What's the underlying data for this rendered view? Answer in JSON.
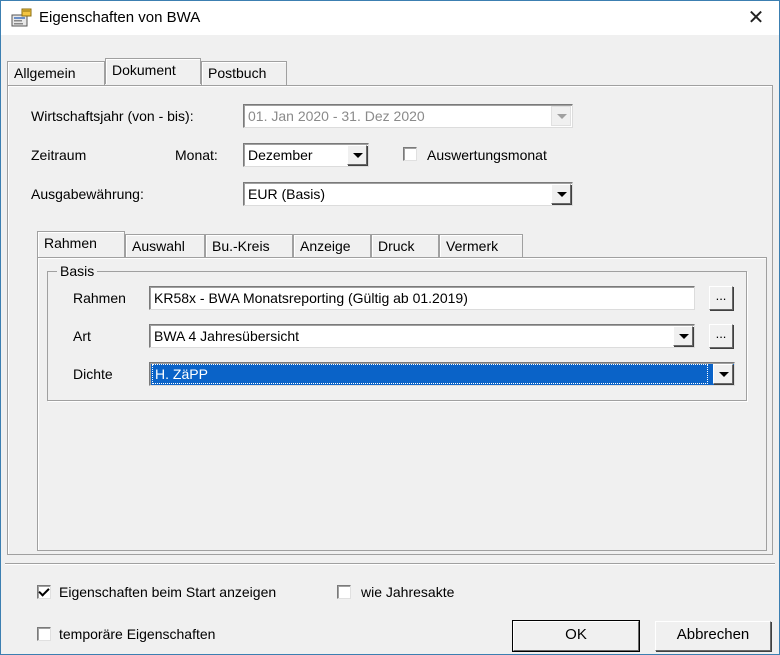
{
  "window": {
    "title": "Eigenschaften von BWA",
    "close_glyph": "✕",
    "title_icon": "properties-icon"
  },
  "tabs": [
    "Allgemein",
    "Dokument",
    "Postbuch"
  ],
  "active_tab": "Dokument",
  "fields": {
    "fiscal_year_label": "Wirtschaftsjahr (von - bis):",
    "fiscal_year_value": "01. Jan 2020  -  31. Dez 2020",
    "period_label": "Zeitraum",
    "month_label": "Monat:",
    "month_value": "Dezember",
    "eval_month_label": "Auswertungsmonat",
    "currency_label": "Ausgabewährung:",
    "currency_value": "EUR (Basis)"
  },
  "subtabs": [
    "Rahmen",
    "Auswahl",
    "Bu.-Kreis",
    "Anzeige",
    "Druck",
    "Vermerk"
  ],
  "active_subtab": "Rahmen",
  "basis": {
    "group_title": "Basis",
    "rahmen_label": "Rahmen",
    "rahmen_value": "KR58x - BWA Monatsreporting (Gültig ab 01.2019)",
    "art_label": "Art",
    "art_value": "BWA 4 Jahresübersicht",
    "dichte_label": "Dichte",
    "dichte_value": "H. ZäPP",
    "dots_label": "..."
  },
  "footer": {
    "show_on_start_label": "Eigenschaften beim Start anzeigen",
    "show_on_start_checked": true,
    "like_annual_label": "wie Jahresakte",
    "like_annual_checked": false,
    "temporary_label": "temporäre Eigenschaften",
    "temporary_checked": false,
    "ok_label": "OK",
    "cancel_label": "Abbrechen"
  },
  "colors": {
    "selection": "#0a63c8",
    "window_border": "#3c7fb1",
    "face": "#f0f0f0"
  }
}
